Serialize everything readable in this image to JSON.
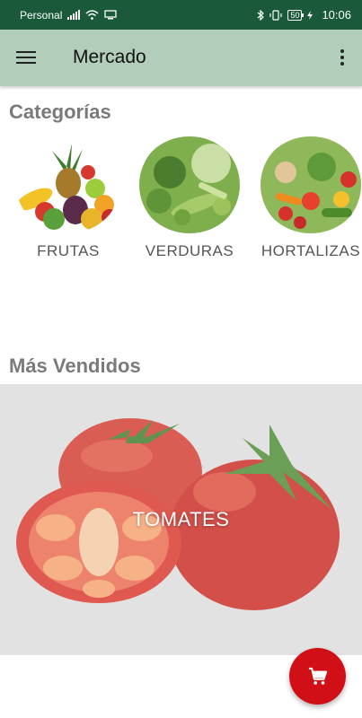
{
  "status_bar": {
    "carrier": "Personal",
    "battery": "50",
    "time": "10:06"
  },
  "app_bar": {
    "title": "Mercado",
    "menu_icon": "hamburger-menu-icon",
    "more_icon": "more-vert-icon"
  },
  "categories": {
    "title": "Categorías",
    "items": [
      {
        "label": "FRUTAS"
      },
      {
        "label": "VERDURAS"
      },
      {
        "label": "HORTALIZAS"
      }
    ]
  },
  "best_sellers": {
    "title": "Más Vendidos",
    "items": [
      {
        "label": "TOMATES"
      }
    ]
  },
  "fab": {
    "icon": "shopping-cart-icon",
    "color": "#d10f16"
  },
  "colors": {
    "status_bar": "#1a5a3b",
    "app_bar": "#b3cdbb",
    "section_title": "#7a7a7a"
  }
}
